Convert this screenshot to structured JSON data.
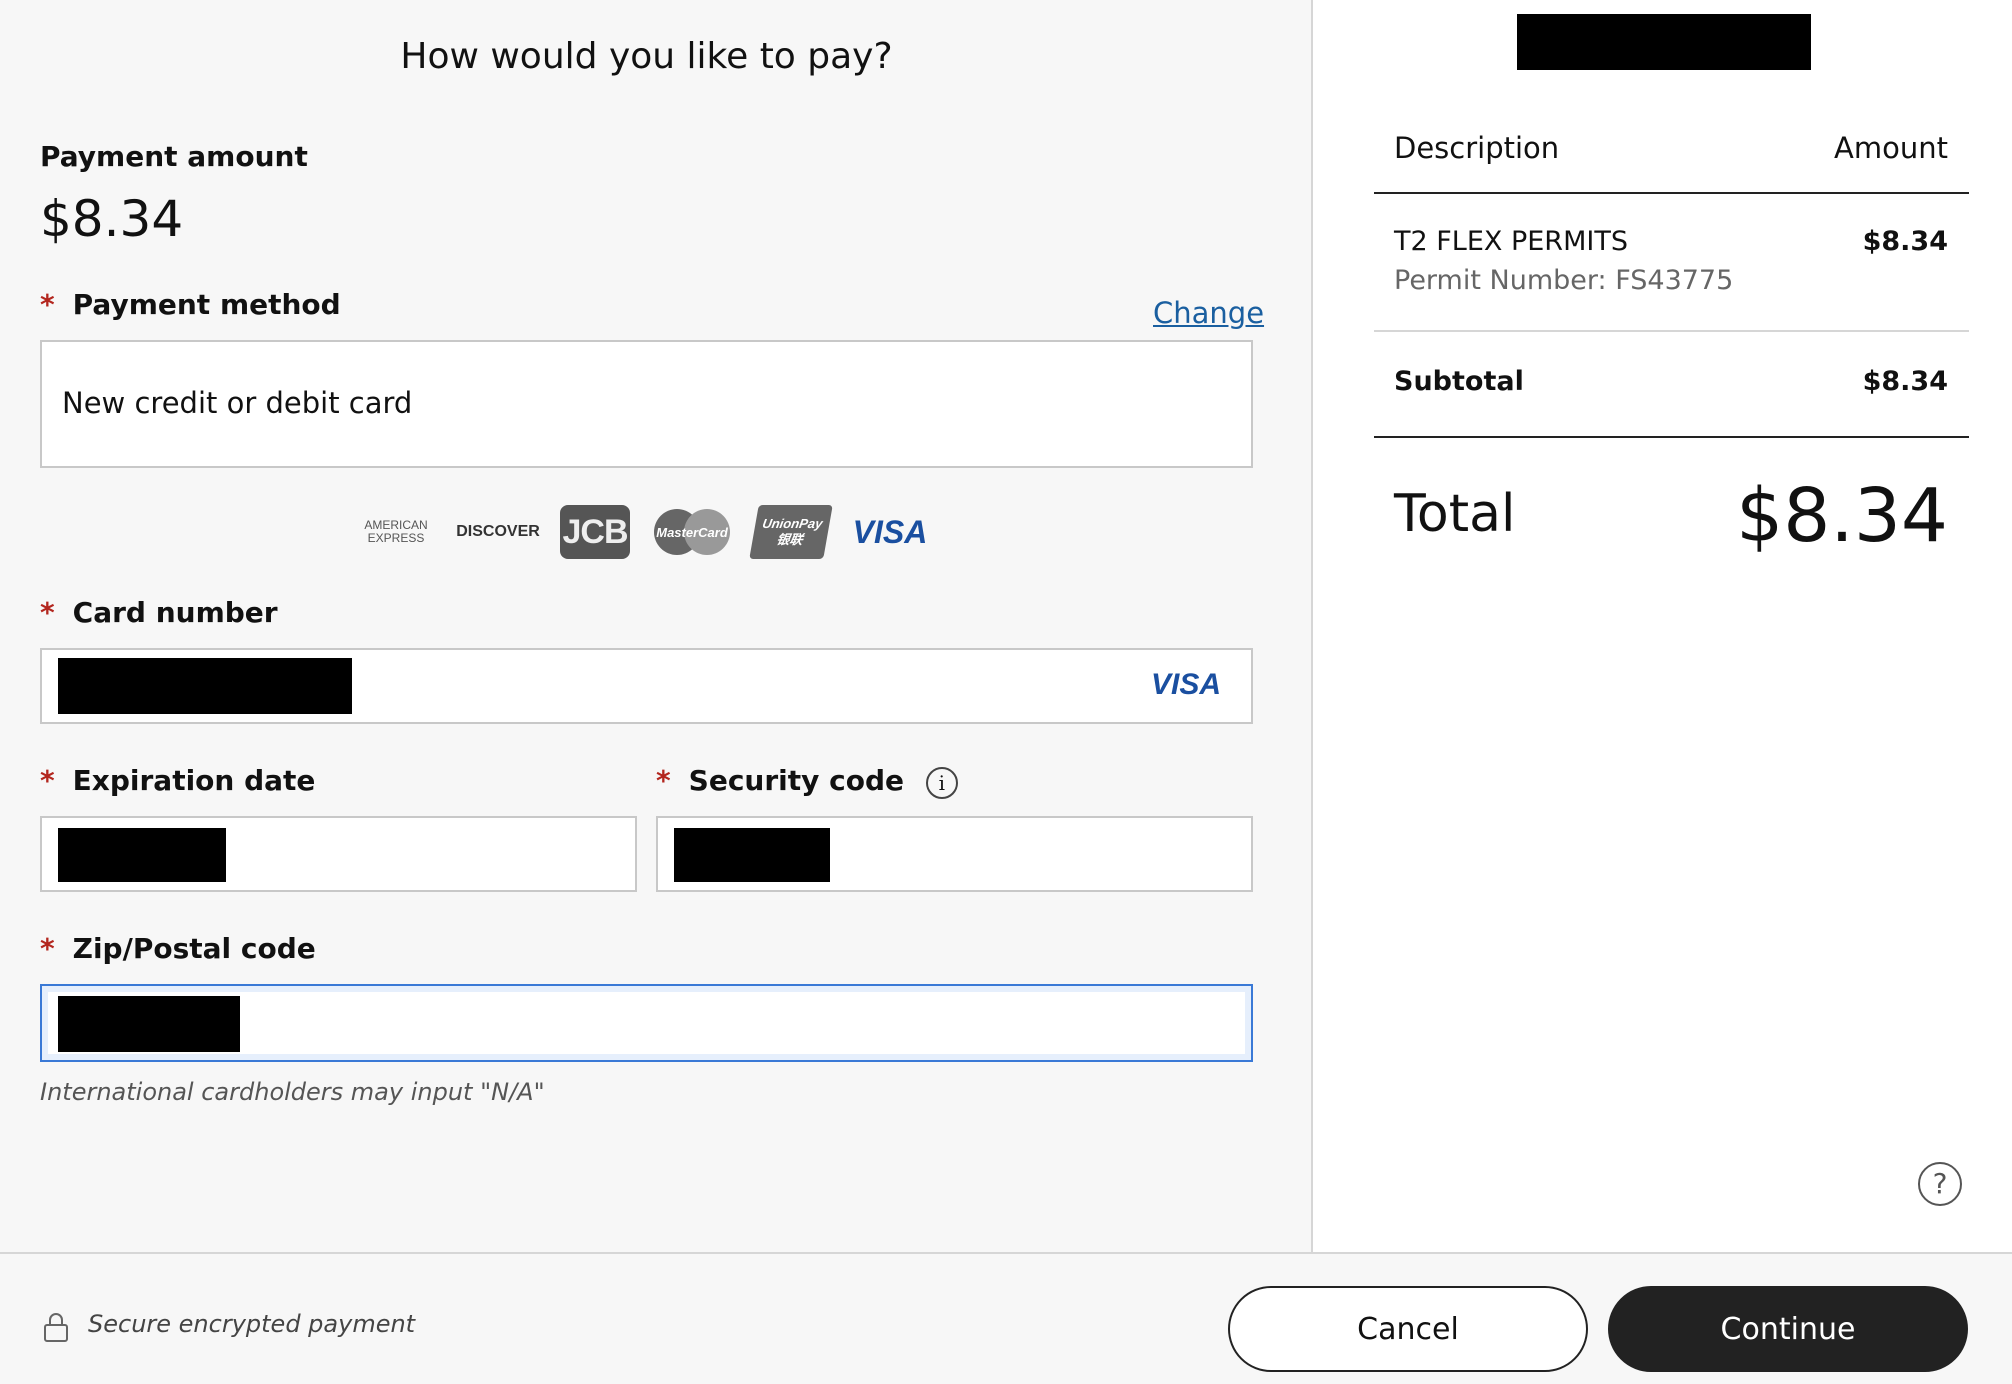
{
  "form": {
    "title": "How would you like to pay?",
    "payment_amount_label": "Payment amount",
    "payment_amount": "$8.34",
    "payment_method_label": "Payment method",
    "change_link": "Change",
    "payment_method_value": "New credit or debit card",
    "card_logos": [
      "AMERICAN EXPRESS",
      "DISCOVER",
      "JCB",
      "MasterCard",
      "UnionPay 银联",
      "VISA"
    ],
    "card_number_label": "Card number",
    "card_brand_detected": "VISA",
    "expiration_label": "Expiration date",
    "security_code_label": "Security code",
    "info_icon": "i",
    "zip_label": "Zip/Postal code",
    "zip_hint": "International cardholders may input \"N/A\"",
    "required_mark": "*"
  },
  "receipt": {
    "col_description": "Description",
    "col_amount": "Amount",
    "item_name": "T2 FLEX PERMITS",
    "item_detail": "Permit Number: FS43775",
    "item_amount": "$8.34",
    "subtotal_label": "Subtotal",
    "subtotal_value": "$8.34",
    "total_label": "Total",
    "total_value": "$8.34"
  },
  "help": {
    "icon": "help-chat-icon",
    "glyph": "?"
  },
  "footer": {
    "secure_text": "Secure encrypted payment",
    "cancel_label": "Cancel",
    "continue_label": "Continue"
  },
  "colors": {
    "required": "#b3261e",
    "link": "#1a5fa0",
    "primary_button": "#222222",
    "focus": "#3a79d6"
  }
}
